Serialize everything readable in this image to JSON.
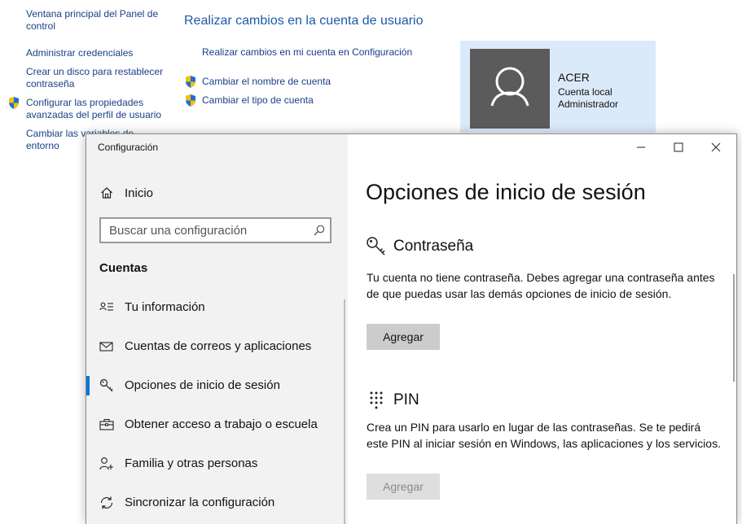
{
  "control_panel": {
    "left_links": [
      "Ventana principal del Panel de control",
      "Administrar credenciales",
      "Crear un disco para restablecer contraseña",
      "Configurar las propiedades avanzadas del perfil de usuario",
      "Cambiar las variables de entorno"
    ],
    "title": "Realizar cambios en la cuenta de usuario",
    "tasks": [
      "Realizar cambios en mi cuenta en Configuración",
      "Cambiar el nombre de cuenta",
      "Cambiar el tipo de cuenta"
    ],
    "account": {
      "name": "ACER",
      "type": "Cuenta local",
      "role": "Administrador"
    }
  },
  "settings": {
    "window_title": "Configuración",
    "home_label": "Inicio",
    "search_placeholder": "Buscar una configuración",
    "section_label": "Cuentas",
    "nav_items": [
      {
        "label": "Tu información",
        "icon": "person-card-icon"
      },
      {
        "label": "Cuentas de correos y aplicaciones",
        "icon": "mail-icon"
      },
      {
        "label": "Opciones de inicio de sesión",
        "icon": "key-icon",
        "active": true
      },
      {
        "label": "Obtener acceso a trabajo o escuela",
        "icon": "briefcase-icon"
      },
      {
        "label": "Familia y otras personas",
        "icon": "add-person-icon"
      },
      {
        "label": "Sincronizar la configuración",
        "icon": "sync-icon"
      }
    ],
    "page_title": "Opciones de inicio de sesión",
    "password": {
      "heading": "Contraseña",
      "description": "Tu cuenta no tiene contraseña. Debes agregar una contraseña antes de que puedas usar las demás opciones de inicio de sesión.",
      "button": "Agregar"
    },
    "pin": {
      "heading": "PIN",
      "description": "Crea un PIN para usarlo en lugar de las contraseñas. Se te pedirá este PIN al iniciar sesión en Windows, las aplicaciones y los servicios.",
      "button": "Agregar"
    },
    "accent_color": "#0078d7"
  }
}
